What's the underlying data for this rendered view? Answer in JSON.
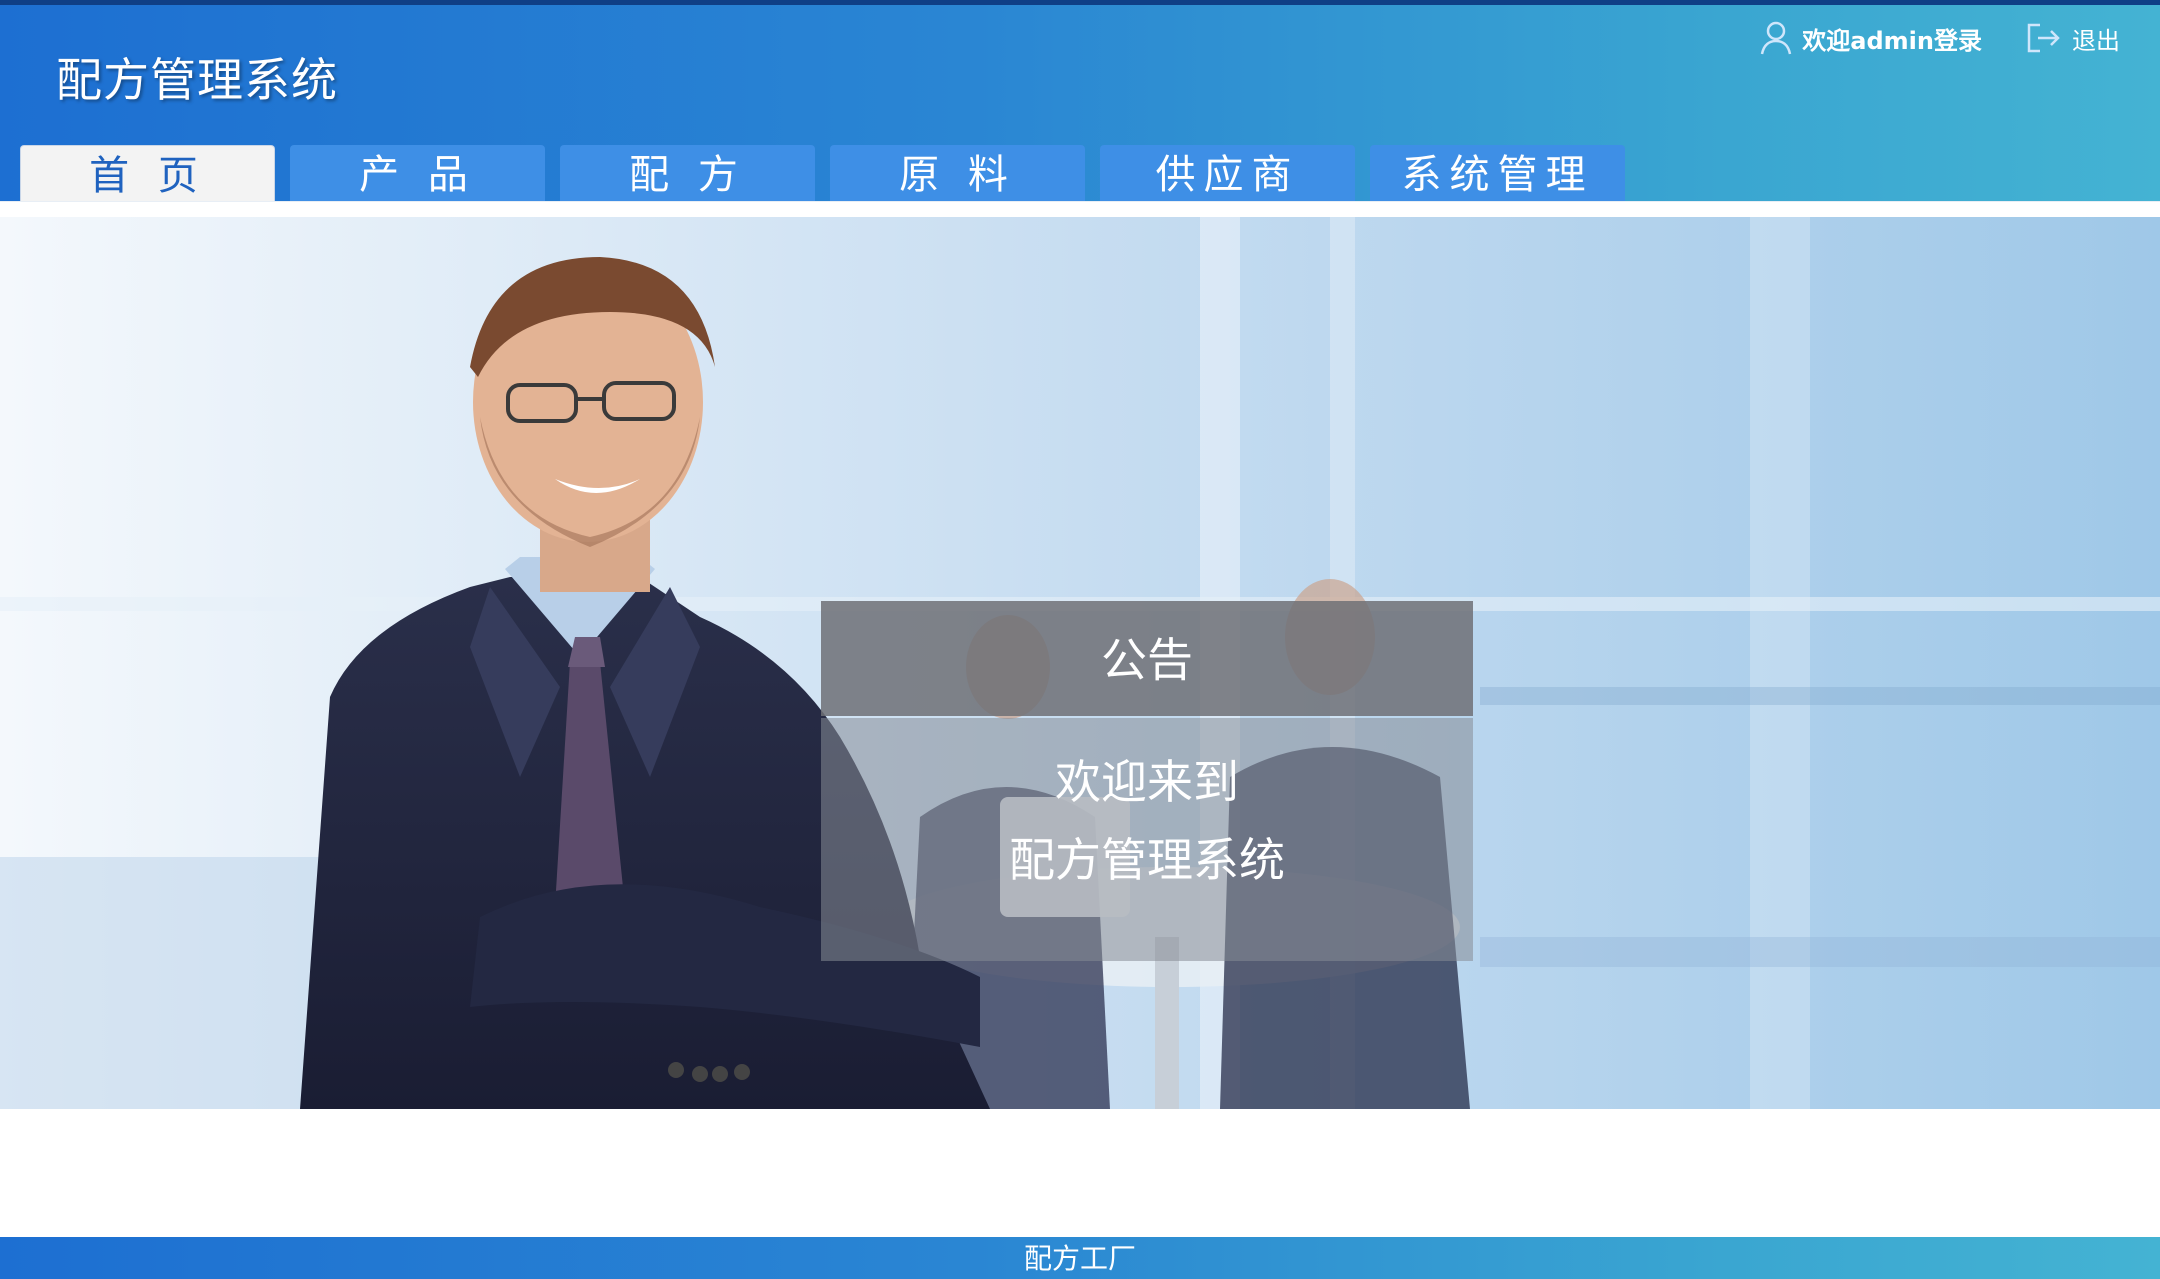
{
  "header": {
    "app_title": "配方管理系统",
    "welcome_text": "欢迎admin登录",
    "logout_label": "退出"
  },
  "nav": {
    "tabs": [
      {
        "label": "首 页",
        "active": true
      },
      {
        "label": "产 品",
        "active": false
      },
      {
        "label": "配 方",
        "active": false
      },
      {
        "label": "原 料",
        "active": false
      },
      {
        "label": "供应商",
        "active": false
      },
      {
        "label": "系统管理",
        "active": false
      }
    ]
  },
  "notice": {
    "title": "公告",
    "line1": "欢迎来到",
    "line2": "配方管理系统"
  },
  "footer": {
    "text": "配方工厂"
  },
  "icons": {
    "user": "user-icon",
    "logout": "logout-icon"
  },
  "colors": {
    "header_start": "#1d6fd2",
    "header_end": "#44b3d3",
    "tab_bg": "#3e8fe6",
    "tab_active_bg": "#f3f3f3",
    "tab_active_text": "#1f62bf"
  }
}
